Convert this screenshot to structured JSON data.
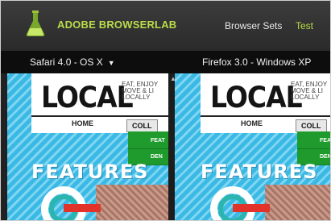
{
  "app": {
    "title": "ADOBE BROWSERLAB",
    "nav": [
      "Browser Sets",
      "Test"
    ]
  },
  "browsers": {
    "left": "Safari 4.0 - OS X",
    "right": "Firefox 3.0 - Windows XP"
  },
  "site": {
    "logo": "LOCAL",
    "tagline_lines": [
      "EAT, ENJOY",
      "MOVE & LI",
      "LOCALLY"
    ],
    "nav_home": "HOME",
    "nav_collections": "COLL",
    "dropdown": [
      "FEAT",
      "DEN"
    ],
    "features_heading": "FEATURES"
  },
  "colors": {
    "accent_green": "#b9dc4a",
    "pane_blue": "#39b9e4",
    "dropdown_green": "#1f9b2e"
  }
}
